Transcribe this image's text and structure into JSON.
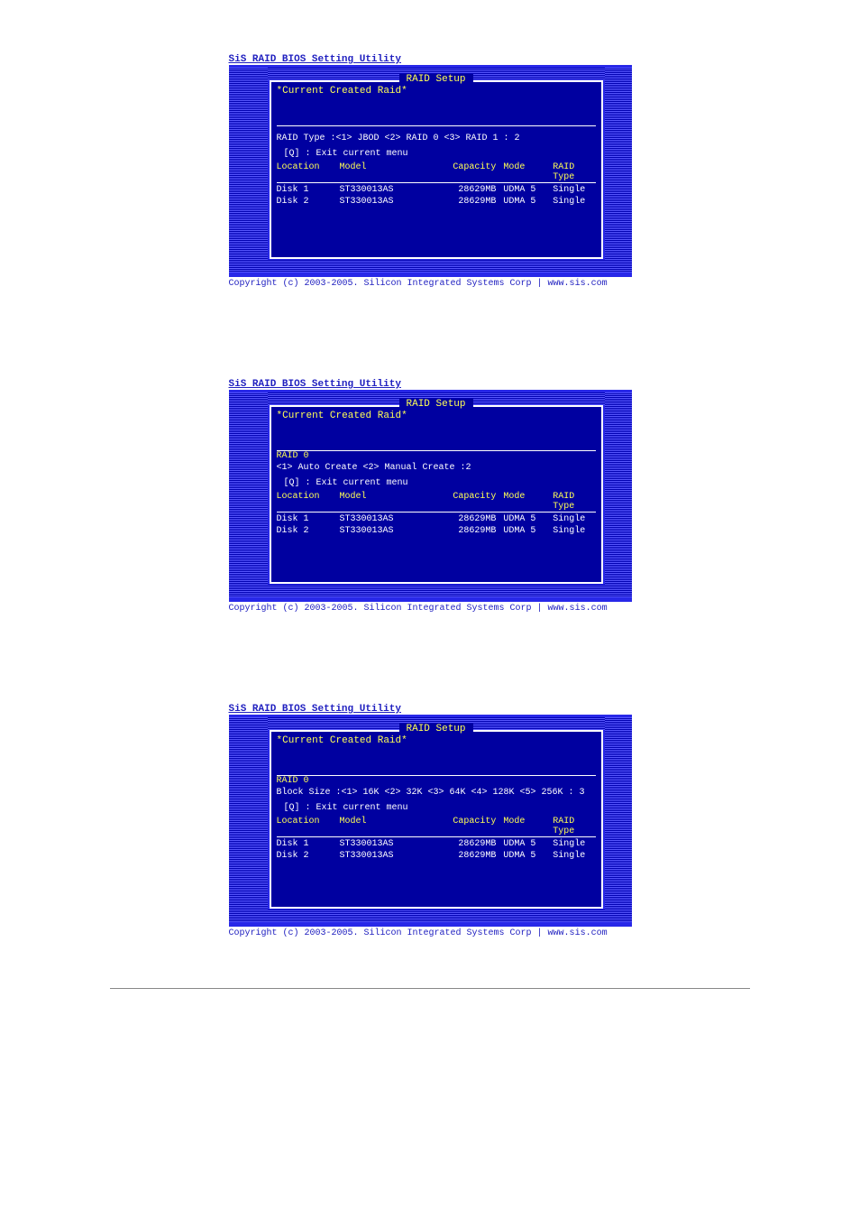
{
  "title_bar": "SiS RAID BIOS Setting Utility",
  "panel_title": "RAID Setup",
  "current_raid": "*Current Created Raid*",
  "copyright": "Copyright (c) 2003-2005. Silicon Integrated Systems Corp   |   www.sis.com",
  "cols": {
    "location": "Location",
    "model": "Model",
    "capacity": "Capacity",
    "mode": "Mode",
    "raid_type": "RAID Type"
  },
  "disks": [
    {
      "location": "Disk 1",
      "model": "ST330013AS",
      "capacity": "28629MB",
      "mode": "UDMA 5",
      "type": "Single"
    },
    {
      "location": "Disk 2",
      "model": "ST330013AS",
      "capacity": "28629MB",
      "mode": "UDMA 5",
      "type": "Single"
    }
  ],
  "exit_hint": "[Q] : Exit current menu",
  "screens": {
    "s1": {
      "prompt": "RAID Type :<1> JBOD <2> RAID 0 <3> RAID 1  :  2"
    },
    "s2": {
      "heading": "RAID 0",
      "prompt": "<1> Auto Create <2> Manual Create :2"
    },
    "s3": {
      "heading": "RAID 0",
      "prompt": "Block Size :<1> 16K <2> 32K <3> 64K <4> 128K <5> 256K : 3"
    }
  }
}
